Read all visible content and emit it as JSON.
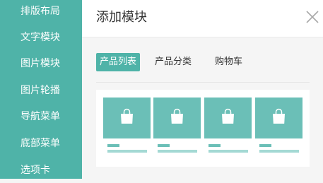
{
  "sidebar": {
    "items": [
      {
        "label": "排版布局"
      },
      {
        "label": "文字模块"
      },
      {
        "label": "图片模块"
      },
      {
        "label": "图片轮播"
      },
      {
        "label": "导航菜单"
      },
      {
        "label": "底部菜单"
      },
      {
        "label": "选项卡"
      }
    ]
  },
  "dialog": {
    "title": "添加模块",
    "close_icon": "close-icon",
    "tabs": [
      {
        "label": "产品列表",
        "active": true
      },
      {
        "label": "产品分类",
        "active": false
      },
      {
        "label": "购物车",
        "active": false
      }
    ],
    "product_cards": [
      {
        "icon": "shopping-bag-icon"
      },
      {
        "icon": "shopping-bag-icon"
      },
      {
        "icon": "shopping-bag-icon"
      },
      {
        "icon": "shopping-bag-icon"
      }
    ]
  },
  "colors": {
    "accent": "#4fb3a8",
    "card_image": "#6bbfb7",
    "card_line_light": "#a4d9d4",
    "panel_background": "#f5f5f5"
  }
}
